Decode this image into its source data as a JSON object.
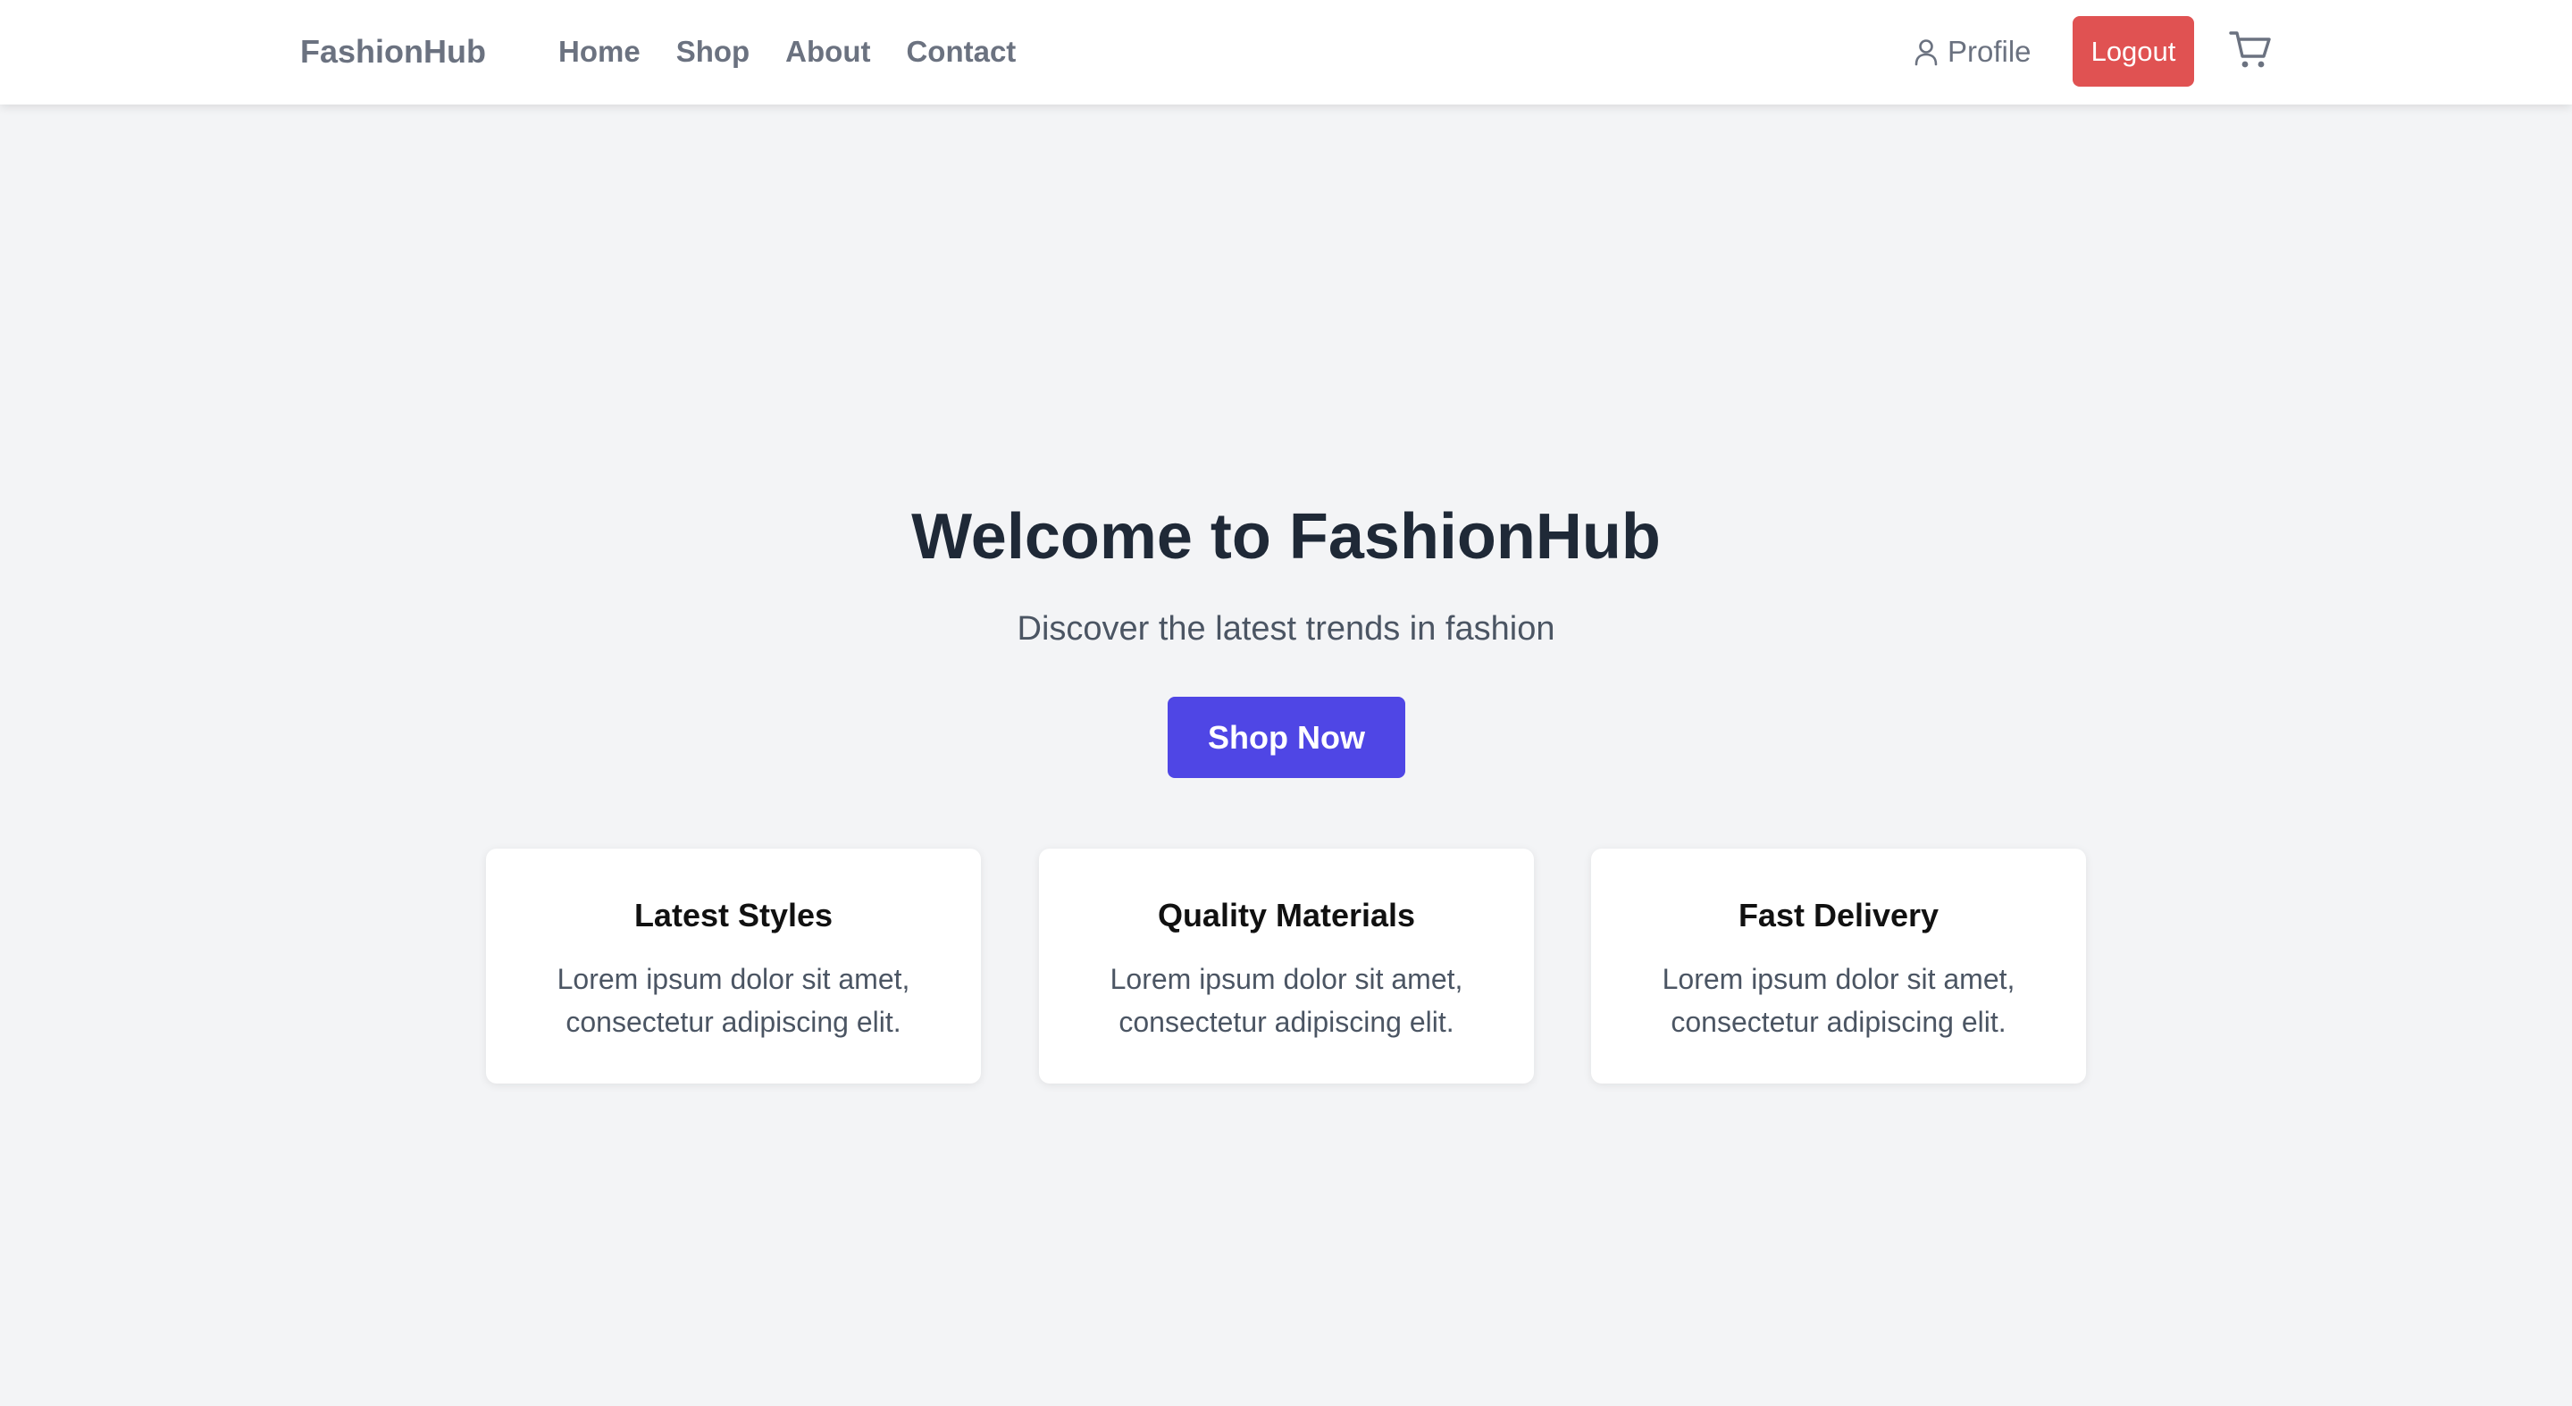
{
  "navbar": {
    "brand": "FashionHub",
    "links": [
      "Home",
      "Shop",
      "About",
      "Contact"
    ],
    "profile_label": "Profile",
    "profile_icon": "user-icon",
    "logout_label": "Logout",
    "cart_icon": "shopping-cart-icon"
  },
  "hero": {
    "title": "Welcome to FashionHub",
    "subtitle": "Discover the latest trends in fashion",
    "cta_label": "Shop Now"
  },
  "features": [
    {
      "title": "Latest Styles",
      "text": "Lorem ipsum dolor sit amet, consectetur adipiscing elit."
    },
    {
      "title": "Quality Materials",
      "text": "Lorem ipsum dolor sit amet, consectetur adipiscing elit."
    },
    {
      "title": "Fast Delivery",
      "text": "Lorem ipsum dolor sit amet, consectetur adipiscing elit."
    }
  ],
  "colors": {
    "accent": "#4f46e5",
    "logout": "#e05252",
    "nav_text": "#6b7280",
    "heading": "#1f2937",
    "background": "#f3f4f6"
  }
}
